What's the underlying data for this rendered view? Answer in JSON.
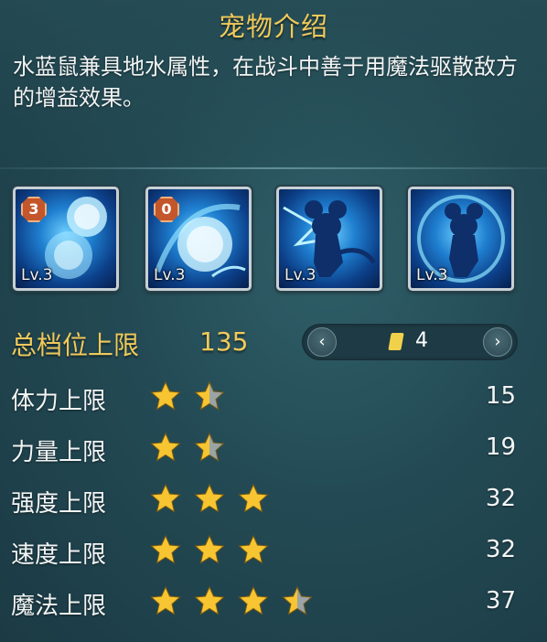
{
  "title": "宠物介绍",
  "description": "水蓝鼠兼具地水属性，在战斗中善于用魔法驱散敌方的增益效果。",
  "skills": [
    {
      "level": "Lv.3",
      "cost": "3",
      "icon": "water-orb-icon"
    },
    {
      "level": "Lv.3",
      "cost": "0",
      "icon": "water-sphere-icon"
    },
    {
      "level": "Lv.3",
      "cost": null,
      "icon": "water-mouse-icon"
    },
    {
      "level": "Lv.3",
      "cost": null,
      "icon": "water-mouse-aura-icon"
    }
  ],
  "total": {
    "label": "总档位上限",
    "value": "135"
  },
  "pager": {
    "page": "4",
    "prev_icon": "chevron-left-icon",
    "next_icon": "chevron-right-icon"
  },
  "stats": [
    {
      "label": "体力上限",
      "stars": 1.5,
      "value": "15"
    },
    {
      "label": "力量上限",
      "stars": 1.5,
      "value": "19"
    },
    {
      "label": "强度上限",
      "stars": 3,
      "value": "32"
    },
    {
      "label": "速度上限",
      "stars": 3,
      "value": "32"
    },
    {
      "label": "魔法上限",
      "stars": 3.5,
      "value": "37"
    }
  ],
  "colors": {
    "gold": "#f0c95a",
    "star": "#f7c531",
    "star_empty": "#9aa3a6"
  }
}
